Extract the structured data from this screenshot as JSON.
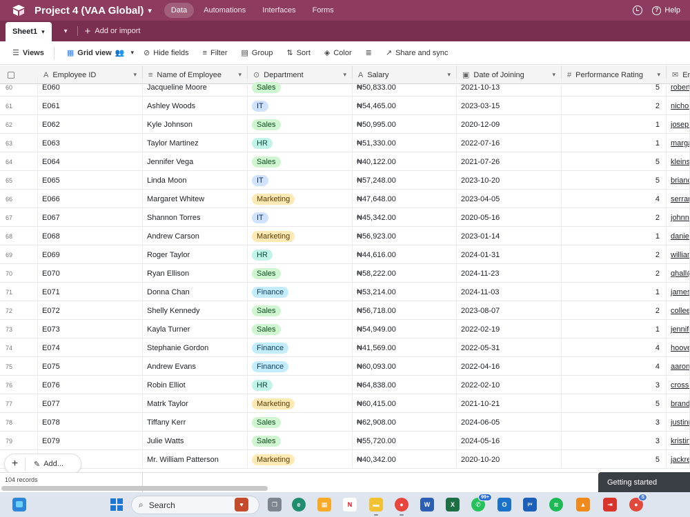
{
  "header": {
    "project_title": "Project 4 (VAA Global)",
    "tabs": [
      {
        "label": "Data",
        "active": true
      },
      {
        "label": "Automations",
        "active": false
      },
      {
        "label": "Interfaces",
        "active": false
      },
      {
        "label": "Forms",
        "active": false
      }
    ],
    "help_label": "Help"
  },
  "sheet_bar": {
    "active_sheet": "Sheet1",
    "add_import_label": "Add or import"
  },
  "toolbar": {
    "views_label": "Views",
    "grid_view_label": "Grid view",
    "hide_fields_label": "Hide fields",
    "filter_label": "Filter",
    "group_label": "Group",
    "sort_label": "Sort",
    "color_label": "Color",
    "share_label": "Share and sync"
  },
  "columns": [
    {
      "label": "Employee ID",
      "icon": "text-icon"
    },
    {
      "label": "Name of Employee",
      "icon": "long-text-icon"
    },
    {
      "label": "Department",
      "icon": "single-select-icon"
    },
    {
      "label": "Salary",
      "icon": "text-icon"
    },
    {
      "label": "Date of Joining",
      "icon": "calendar-icon"
    },
    {
      "label": "Performance Rating",
      "icon": "number-icon"
    },
    {
      "label": "Em",
      "icon": "email-icon"
    }
  ],
  "departments": {
    "Sales": {
      "bg": "#cff5d1",
      "fg": "#0b4f1a"
    },
    "IT": {
      "bg": "#d1e2ff",
      "fg": "#0b2e6b"
    },
    "HR": {
      "bg": "#c2f5e9",
      "fg": "#0a4a3b"
    },
    "Marketing": {
      "bg": "#ffeab6",
      "fg": "#5a3b00"
    },
    "Finance": {
      "bg": "#c4ecff",
      "fg": "#0b3d5c"
    }
  },
  "rows": [
    {
      "n": "60",
      "id": "E060",
      "name": "Jacqueline Moore",
      "dept": "Sales",
      "salary": "₦50,833.00",
      "date": "2021-10-13",
      "rating": "5",
      "email": "robert"
    },
    {
      "n": "61",
      "id": "E061",
      "name": "Ashley Woods",
      "dept": "IT",
      "salary": "₦54,465.00",
      "date": "2023-03-15",
      "rating": "2",
      "email": "nichol"
    },
    {
      "n": "62",
      "id": "E062",
      "name": "Kyle Johnson",
      "dept": "Sales",
      "salary": "₦50,995.00",
      "date": "2020-12-09",
      "rating": "1",
      "email": "joseph"
    },
    {
      "n": "63",
      "id": "E063",
      "name": "Taylor Martinez",
      "dept": "HR",
      "salary": "₦51,330.00",
      "date": "2022-07-16",
      "rating": "1",
      "email": "marga"
    },
    {
      "n": "64",
      "id": "E064",
      "name": "Jennifer Vega",
      "dept": "Sales",
      "salary": "₦40,122.00",
      "date": "2021-07-26",
      "rating": "5",
      "email": "kleins"
    },
    {
      "n": "65",
      "id": "E065",
      "name": "Linda Moon",
      "dept": "IT",
      "salary": "₦57,248.00",
      "date": "2023-10-20",
      "rating": "5",
      "email": "brianc"
    },
    {
      "n": "66",
      "id": "E066",
      "name": "Margaret Whitew",
      "dept": "Marketing",
      "salary": "₦47,648.00",
      "date": "2023-04-05",
      "rating": "4",
      "email": "serran"
    },
    {
      "n": "67",
      "id": "E067",
      "name": "Shannon Torres",
      "dept": "IT",
      "salary": "₦45,342.00",
      "date": "2020-05-16",
      "rating": "2",
      "email": "johnny"
    },
    {
      "n": "68",
      "id": "E068",
      "name": "Andrew Carson",
      "dept": "Marketing",
      "salary": "₦56,923.00",
      "date": "2023-01-14",
      "rating": "1",
      "email": "daniel"
    },
    {
      "n": "69",
      "id": "E069",
      "name": "Roger Taylor",
      "dept": "HR",
      "salary": "₦44,616.00",
      "date": "2024-01-31",
      "rating": "2",
      "email": "william"
    },
    {
      "n": "70",
      "id": "E070",
      "name": "Ryan Ellison",
      "dept": "Sales",
      "salary": "₦58,222.00",
      "date": "2024-11-23",
      "rating": "2",
      "email": "qhall@"
    },
    {
      "n": "71",
      "id": "E071",
      "name": "Donna Chan",
      "dept": "Finance",
      "salary": "₦53,214.00",
      "date": "2024-11-03",
      "rating": "1",
      "email": "james"
    },
    {
      "n": "72",
      "id": "E072",
      "name": "Shelly Kennedy",
      "dept": "Sales",
      "salary": "₦56,718.00",
      "date": "2023-08-07",
      "rating": "2",
      "email": "collee"
    },
    {
      "n": "73",
      "id": "E073",
      "name": "Kayla Turner",
      "dept": "Sales",
      "salary": "₦54,949.00",
      "date": "2022-02-19",
      "rating": "1",
      "email": "jennife"
    },
    {
      "n": "74",
      "id": "E074",
      "name": "Stephanie Gordon",
      "dept": "Finance",
      "salary": "₦41,569.00",
      "date": "2022-05-31",
      "rating": "4",
      "email": "hoove"
    },
    {
      "n": "75",
      "id": "E075",
      "name": "Andrew Evans",
      "dept": "Finance",
      "salary": "₦60,093.00",
      "date": "2022-04-16",
      "rating": "4",
      "email": "aaronl"
    },
    {
      "n": "76",
      "id": "E076",
      "name": "Robin Elliot",
      "dept": "HR",
      "salary": "₦64,838.00",
      "date": "2022-02-10",
      "rating": "3",
      "email": "crossi"
    },
    {
      "n": "77",
      "id": "E077",
      "name": "Matrk Taylor",
      "dept": "Marketing",
      "salary": "₦60,415.00",
      "date": "2021-10-21",
      "rating": "5",
      "email": "brand"
    },
    {
      "n": "78",
      "id": "E078",
      "name": "Tiffany Kerr",
      "dept": "Sales",
      "salary": "₦62,908.00",
      "date": "2024-06-05",
      "rating": "3",
      "email": "justinr"
    },
    {
      "n": "79",
      "id": "E079",
      "name": "Julie Watts",
      "dept": "Sales",
      "salary": "₦55,720.00",
      "date": "2024-05-16",
      "rating": "3",
      "email": "kristin"
    },
    {
      "n": "",
      "id": "",
      "name": "Mr. William Patterson",
      "dept": "Marketing",
      "salary": "₦40,342.00",
      "date": "2020-10-20",
      "rating": "5",
      "email": "jackre"
    }
  ],
  "footer": {
    "records_label": "104 records",
    "add_label": "Add...",
    "getting_started_label": "Getting started"
  },
  "taskbar": {
    "search_label": "Search",
    "whatsapp_badge": "99+",
    "chrome_badge": "S"
  }
}
